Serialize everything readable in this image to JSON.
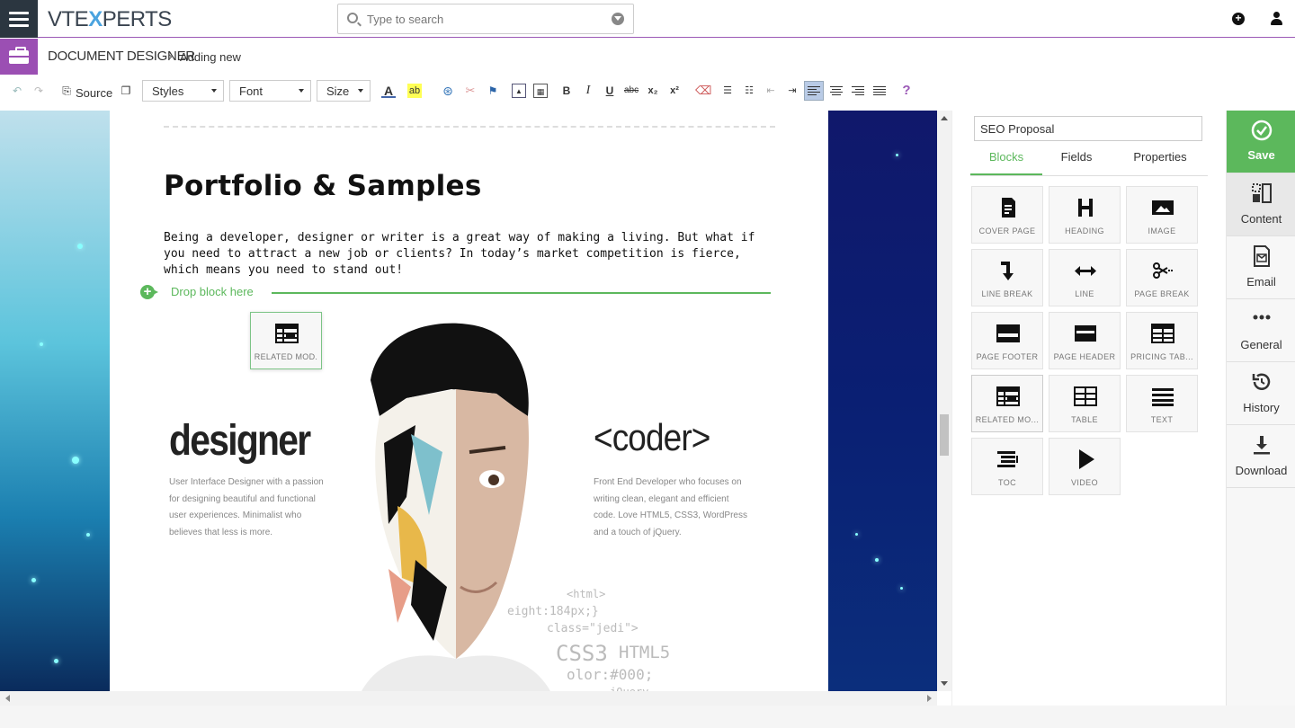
{
  "topbar": {
    "logo_left": "VTE",
    "logo_x": "X",
    "logo_right": "PERTS",
    "search_placeholder": "Type to search"
  },
  "breadcrumb": {
    "module": "DOCUMENT DESIGNER",
    "separator": "›",
    "current": "Adding new"
  },
  "toolbar": {
    "source_label": "Source",
    "styles_label": "Styles",
    "font_label": "Font",
    "size_label": "Size",
    "help": "?"
  },
  "document": {
    "heading": "Portfolio & Samples",
    "paragraph": "Being a developer, designer or writer is a great way of making a living. But what if you need to attract a new job or clients? In today’s market competition is fierce, which means you need to stand out!",
    "drop_label": "Drop block here",
    "dragging_block": "RELATED MOD.",
    "image_text": {
      "designer": "designer",
      "designer_desc": [
        "User Interface Designer with a passion",
        "for designing beautiful and functional",
        "user experiences. Minimalist who",
        "believes that less is more."
      ],
      "coder": "<coder>",
      "coder_desc": [
        "Front End Developer who focuses on",
        "writing clean, elegant and efficient",
        "code. Love HTML5, CSS3, WordPress",
        "and a touch of jQuery."
      ],
      "code_lines": [
        "<html>",
        "eight:184px;}",
        "class=\"jedi\">",
        "CSS3",
        "HTML5",
        "olor:#000;",
        "jQuery"
      ]
    }
  },
  "panel": {
    "name_value": "SEO Proposal",
    "tabs": [
      "Blocks",
      "Fields",
      "Properties"
    ],
    "blocks": [
      "COVER PAGE",
      "HEADING",
      "IMAGE",
      "LINE BREAK",
      "LINE",
      "PAGE BREAK",
      "PAGE FOOTER",
      "PAGE HEADER",
      "PRICING TAB...",
      "RELATED MO...",
      "TABLE",
      "TEXT",
      "TOC",
      "VIDEO"
    ]
  },
  "sidenav": {
    "save": "Save",
    "content": "Content",
    "email": "Email",
    "general": "General",
    "history": "History",
    "download": "Download"
  },
  "colors": {
    "accent_green": "#5cb85c",
    "purple": "#9b4fb3",
    "dark_nav": "#2b3640"
  }
}
